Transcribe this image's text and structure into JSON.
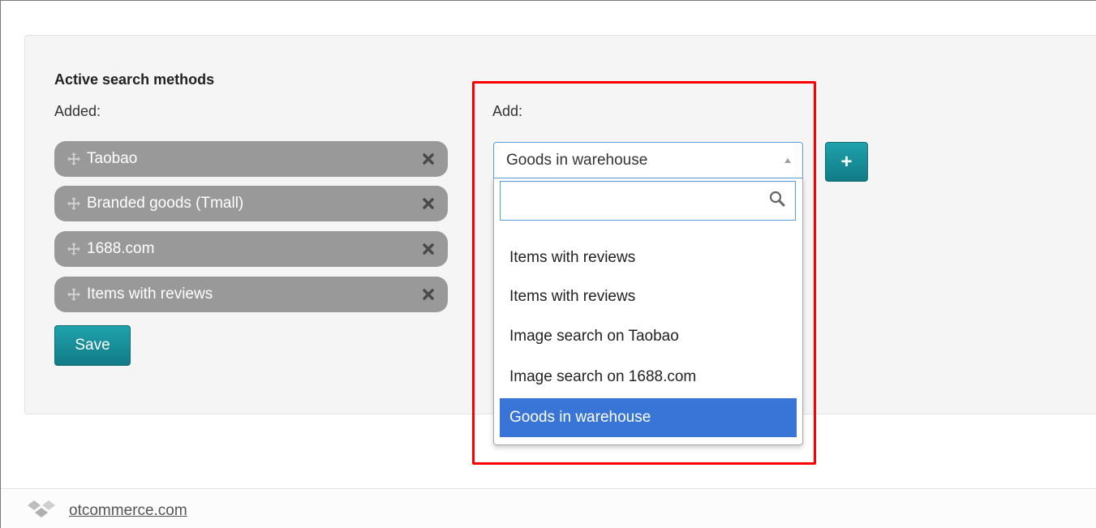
{
  "section": {
    "title": "Active search methods",
    "added_label": "Added:",
    "add_label": "Add:"
  },
  "added_items": [
    {
      "label": "Taobao"
    },
    {
      "label": "Branded goods (Tmall)"
    },
    {
      "label": "1688.com"
    },
    {
      "label": "Items with reviews"
    }
  ],
  "save_label": "Save",
  "select": {
    "value": "Goods in warehouse",
    "search_value": "",
    "options": [
      {
        "label": "Items with reviews"
      },
      {
        "label": "Items with reviews"
      },
      {
        "label": "Image search on Taobao"
      },
      {
        "label": "Image search on 1688.com"
      },
      {
        "label": "Goods in warehouse",
        "selected": true
      }
    ]
  },
  "add_button_label": "+",
  "footer": {
    "link_text": "otcommerce.com"
  },
  "colors": {
    "accent": "#1a8f99",
    "pill_bg": "#999999",
    "highlight_border": "#ff0000",
    "selected_option": "#3875d7"
  },
  "icons": {
    "move": "move-icon",
    "remove": "close-icon",
    "search": "search-icon",
    "dropdown_arrow": "caret-up-icon",
    "logo": "otcommerce-logo-icon"
  }
}
